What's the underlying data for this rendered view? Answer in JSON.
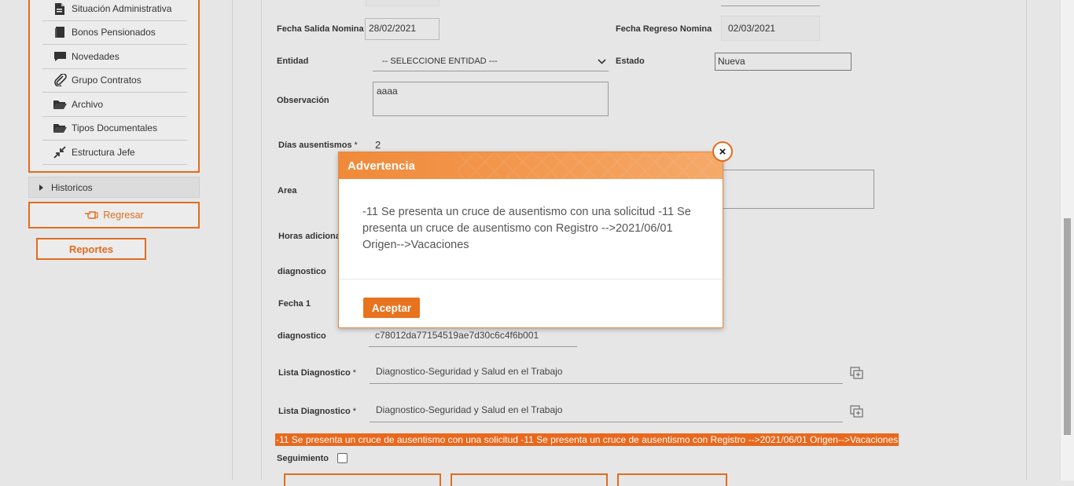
{
  "sidebar": {
    "items": [
      {
        "label": "Situación Administrativa",
        "icon": "document-icon"
      },
      {
        "label": "Bonos Pensionados",
        "icon": "book-icon"
      },
      {
        "label": "Novedades",
        "icon": "comment-icon"
      },
      {
        "label": "Grupo Contratos",
        "icon": "paperclip-icon"
      },
      {
        "label": "Archivo",
        "icon": "folder-open-icon"
      },
      {
        "label": "Tipos Documentales",
        "icon": "folder-open-icon"
      },
      {
        "label": "Estructura Jefe",
        "icon": "compress-icon"
      }
    ],
    "historicos": "Historicos",
    "regresar": "Regresar",
    "reportes": "Reportes"
  },
  "form": {
    "fecha_salida_label": "Fecha Salida Nomina",
    "fecha_salida_value": "28/02/2021",
    "fecha_regreso_label": "Fecha Regreso Nomina",
    "fecha_regreso_value": "02/03/2021",
    "entidad_label": "Entidad",
    "entidad_value": "-- SELECCIONE ENTIDAD ---",
    "estado_label": "Estado",
    "estado_value": "Nueva",
    "observacion_label": "Observación",
    "observacion_value": "aaaa",
    "dias_label": "Días ausentismos",
    "dias_value": "2",
    "required_mark": "*",
    "area_label": "Area",
    "horas_label": "Horas adiciona",
    "diagnostico1_label": "diagnostico",
    "fecha1_label": "Fecha 1",
    "diagnostico2_label": "diagnostico",
    "diagnostico2_value": "c78012da77154519ae7d30c6c4f6b001",
    "lista1_label": "Lista Diagnostico",
    "lista1_value": "Diagnostico-Seguridad y Salud en el Trabajo",
    "lista2_label": "Lista Diagnostico",
    "lista2_value": "Diagnostico-Seguridad y Salud en el Trabajo",
    "error_message": "-11 Se presenta un cruce de ausentismo con una solicitud -11 Se presenta un cruce de ausentismo con Registro -->2021/06/01 Origen-->Vacaciones",
    "seguimiento_label": "Seguimiento"
  },
  "modal": {
    "title": "Advertencia",
    "message": "-11 Se presenta un cruce de ausentismo con una solicitud -11 Se presenta un cruce de ausentismo con Registro -->2021/06/01 Origen-->Vacaciones",
    "accept_label": "Aceptar",
    "close_symbol": "×"
  },
  "colors": {
    "accent": "#e06c1f",
    "modal_header": "#f08a3a",
    "error_bar": "#e8681d"
  }
}
